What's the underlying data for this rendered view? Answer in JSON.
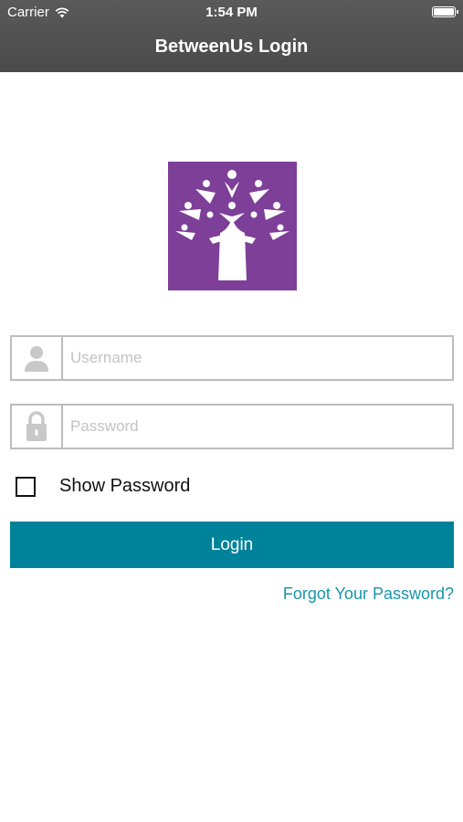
{
  "status_bar": {
    "carrier": "Carrier",
    "time": "1:54 PM"
  },
  "nav": {
    "title": "BetweenUs Login"
  },
  "login_form": {
    "username_placeholder": "Username",
    "password_placeholder": "Password",
    "show_password_label": "Show Password",
    "show_password_checked": false,
    "login_label": "Login",
    "forgot_label": "Forgot Your Password?"
  },
  "icons": [
    "wifi-icon",
    "battery-icon",
    "betweenus-tree-logo",
    "user-icon",
    "lock-icon",
    "checkbox"
  ],
  "colors": {
    "nav_bar": "#505050",
    "logo_bg": "#7d3f98",
    "login_button": "#00829b",
    "link": "#1a94ac"
  }
}
